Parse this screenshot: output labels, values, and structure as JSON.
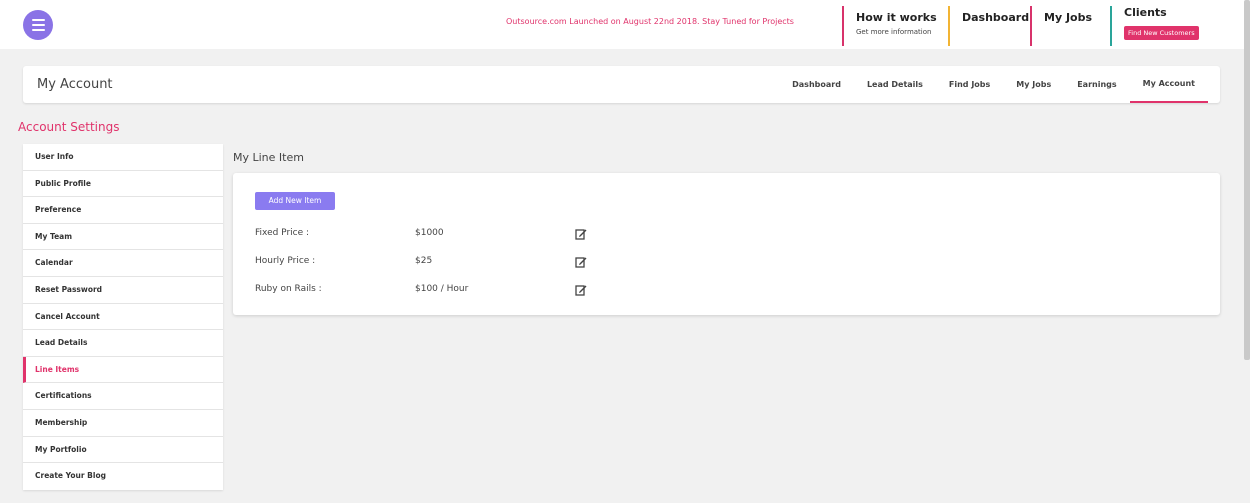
{
  "topbar": {
    "announcement": "Outsource.com Launched on August 22nd 2018. Stay Tuned for Projects",
    "nav": {
      "how_it_works": "How it works",
      "how_it_works_sub": "Get more information",
      "dashboard": "Dashboard",
      "my_jobs": "My Jobs",
      "clients": "Clients",
      "find_customers": "Find New Customers"
    }
  },
  "header": {
    "title": "My Account",
    "tabs": [
      "Dashboard",
      "Lead Details",
      "Find Jobs",
      "My Jobs",
      "Earnings",
      "My Account"
    ],
    "active_tab": "My Account"
  },
  "settings_title": "Account Settings",
  "sidebar": {
    "items": [
      "User Info",
      "Public Profile",
      "Preference",
      "My Team",
      "Calendar",
      "Reset Password",
      "Cancel Account",
      "Lead Details",
      "Line Items",
      "Certifications",
      "Membership",
      "My Portfolio",
      "Create Your Blog"
    ],
    "active": "Line Items"
  },
  "main": {
    "title": "My Line Item",
    "add_button": "Add New Item",
    "line_items": [
      {
        "label": "Fixed Price :",
        "value": "$1000",
        "icon": "edit-icon"
      },
      {
        "label": "Hourly Price :",
        "value": "$25",
        "icon": "edit-icon"
      },
      {
        "label": "Ruby on Rails :",
        "value": "$100 / Hour",
        "icon": "edit-icon"
      }
    ]
  },
  "colors": {
    "accent": "#e0336b",
    "purple": "#8a73e6",
    "yellow": "#f2b434",
    "teal": "#2aa59a"
  }
}
